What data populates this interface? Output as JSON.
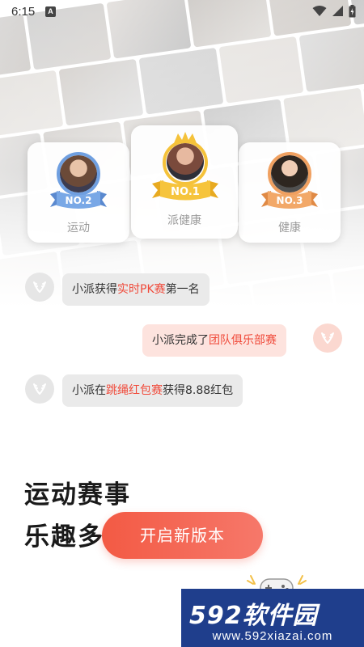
{
  "status_bar": {
    "time": "6:15",
    "notification_letter": "A"
  },
  "rankings": [
    {
      "rank": "NO.2",
      "name": "运动"
    },
    {
      "rank": "NO.1",
      "name": "派健康"
    },
    {
      "rank": "NO.3",
      "name": "健康"
    }
  ],
  "messages": [
    {
      "side": "left",
      "prefix": "小派获得",
      "highlight": "实时PK赛",
      "suffix": "第一名"
    },
    {
      "side": "right",
      "prefix": "小派完成了",
      "highlight": "团队俱乐部赛",
      "suffix": ""
    },
    {
      "side": "left",
      "prefix": "小派在",
      "highlight": "跳绳红包赛",
      "suffix": "获得8.88红包"
    }
  ],
  "headline": {
    "line1": "运动赛事",
    "line2": "乐趣多"
  },
  "cta": {
    "label": "开启新版本"
  },
  "watermark": {
    "brand": "592软件园",
    "url": "www.592xiazai.com"
  },
  "colors": {
    "accent": "#f35a44",
    "highlight": "#f04a3a",
    "gold": "#f5c23a",
    "silver_blue": "#6f9fe0",
    "bronze": "#f0a060",
    "watermark_bg": "#1f3e8c"
  },
  "icons": [
    "wifi-icon",
    "signal-icon",
    "battery-icon",
    "laurel-icon",
    "crown-icon",
    "gamepad-icon"
  ]
}
